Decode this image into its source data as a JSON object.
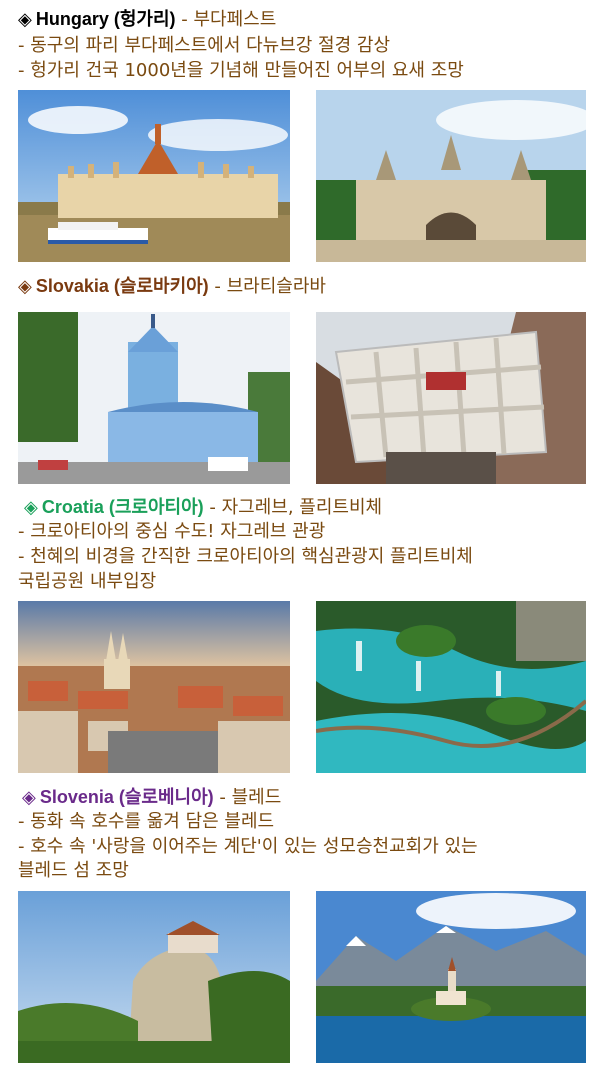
{
  "sections": {
    "hungary": {
      "symbol": "◈",
      "title": "Hungary (헝가리)",
      "subtitle": " - 부다페스트",
      "lines": [
        "- 동구의 파리 부다페스트에서 다뉴브강 절경 감상",
        "- 헝가리 건국 1000년을 기념해 만들어진 어부의 요새 조망"
      ],
      "color": "#000000"
    },
    "slovakia": {
      "symbol": "◈",
      "title": "Slovakia (슬로바키아)",
      "subtitle": " - 브라티슬라바",
      "lines": [],
      "color": "#7a3a10"
    },
    "croatia": {
      "symbol": "◈",
      "title": "Croatia (크로아티아)",
      "subtitle": " - 자그레브, 플리트비체",
      "lines": [
        " - 크로아티아의 중심 수도! 자그레브 관광",
        " - 천혜의 비경을 간직한 크로아티아의 핵심관광지 플리트비체",
        "국립공원 내부입장"
      ],
      "color": "#1aa05a"
    },
    "slovenia": {
      "symbol": "◈",
      "title": "Slovenia (슬로베니아)",
      "subtitle": " - 블레드",
      "lines": [
        "- 동화 속 호수를 옮겨 담은 블레드",
        "- 호수 속 '사랑을 이어주는 계단'이 있는 성모승천교회가 있는",
        "블레드 섬 조망"
      ],
      "color": "#6a2a8a"
    }
  },
  "text_color": "#7a4a10"
}
